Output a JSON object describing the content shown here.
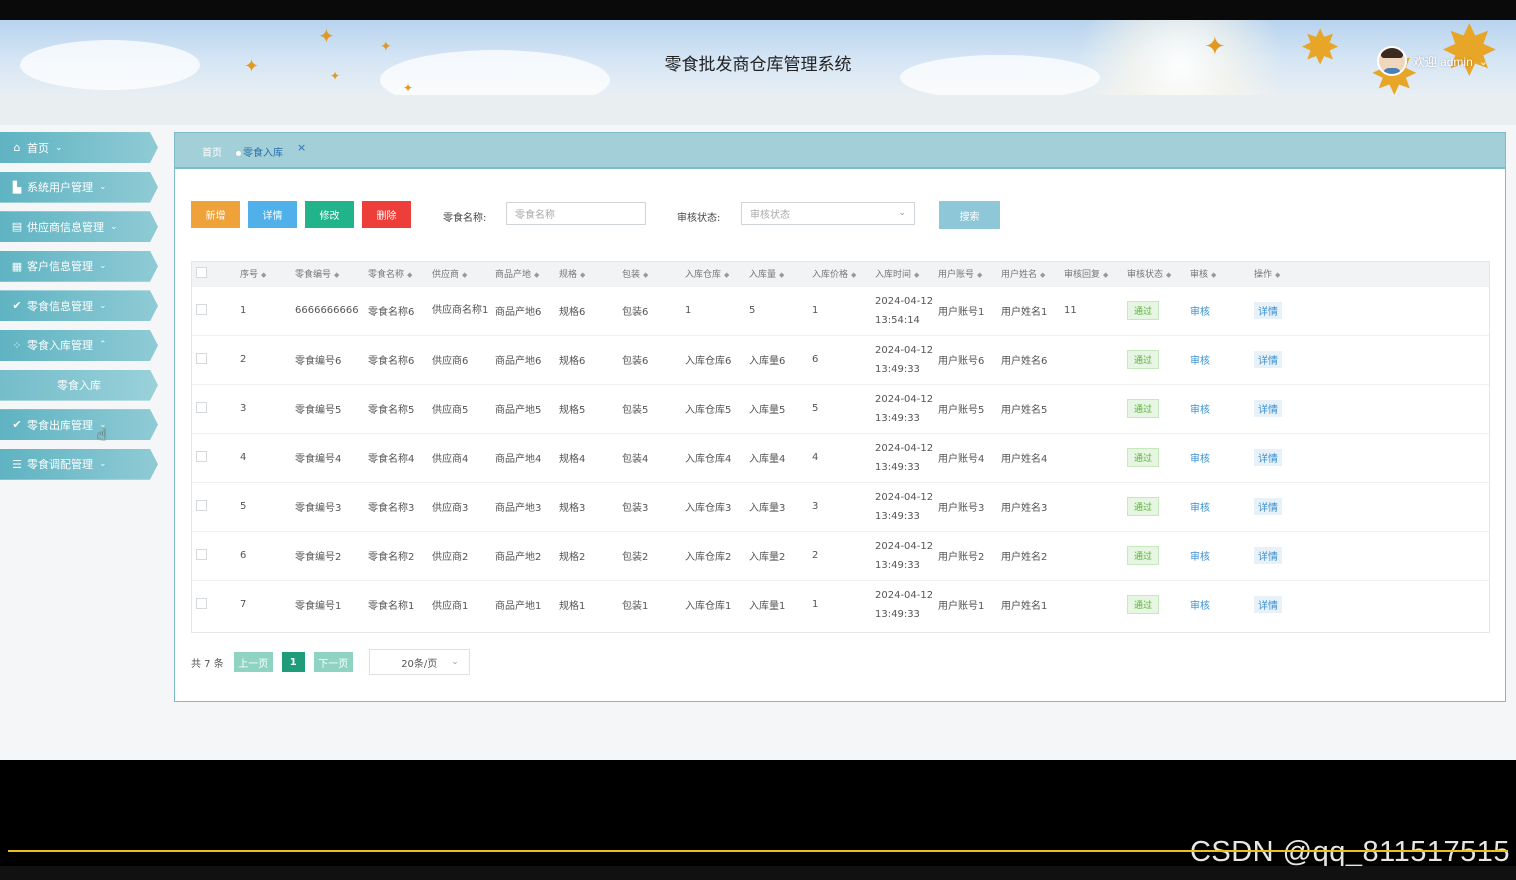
{
  "header": {
    "title": "零食批发商仓库管理系统",
    "welcome": "欢迎 admin"
  },
  "sidebar": {
    "items": [
      {
        "label": "首页",
        "icon": "home-icon",
        "caret": "⌄"
      },
      {
        "label": "系统用户管理",
        "icon": "user-icon",
        "caret": "⌄"
      },
      {
        "label": "供应商信息管理",
        "icon": "card-icon",
        "caret": "⌄"
      },
      {
        "label": "客户信息管理",
        "icon": "grid-icon",
        "caret": "⌄"
      },
      {
        "label": "零食信息管理",
        "icon": "check-circle-icon",
        "caret": "⌄"
      },
      {
        "label": "零食入库管理",
        "icon": "apps-icon",
        "caret": "⌃"
      },
      {
        "label": "零食入库",
        "icon": "",
        "caret": ""
      },
      {
        "label": "零食出库管理",
        "icon": "check-circle-icon",
        "caret": "⌄"
      },
      {
        "label": "零食调配管理",
        "icon": "list-icon",
        "caret": "⌄"
      }
    ]
  },
  "breadcrumb": {
    "home": "首页",
    "current": "零食入库",
    "close": "×"
  },
  "toolbar": {
    "add": "新增",
    "detail": "详情",
    "edit": "修改",
    "delete": "删除",
    "name_label": "零食名称:",
    "name_placeholder": "零食名称",
    "status_label": "审核状态:",
    "status_placeholder": "审核状态",
    "search": "搜索"
  },
  "table": {
    "columns": [
      "序号",
      "零食编号",
      "零食名称",
      "供应商",
      "商品产地",
      "规格",
      "包装",
      "入库仓库",
      "入库量",
      "入库价格",
      "入库时间",
      "用户账号",
      "用户姓名",
      "审核回复",
      "审核状态",
      "审核",
      "操作"
    ],
    "rows": [
      {
        "no": "1",
        "code": "6666666666",
        "name": "零食名称6",
        "supplier": "供应商名称1",
        "origin": "商品产地6",
        "spec": "规格6",
        "pack": "包装6",
        "warehouse": "1",
        "qty": "5",
        "price": "1",
        "time": "2024-04-12 13:54:14",
        "account": "用户账号1",
        "username": "用户姓名1",
        "reply": "11",
        "status": "通过",
        "audit": "审核",
        "op": "详情"
      },
      {
        "no": "2",
        "code": "零食编号6",
        "name": "零食名称6",
        "supplier": "供应商6",
        "origin": "商品产地6",
        "spec": "规格6",
        "pack": "包装6",
        "warehouse": "入库仓库6",
        "qty": "入库量6",
        "price": "6",
        "time": "2024-04-12 13:49:33",
        "account": "用户账号6",
        "username": "用户姓名6",
        "reply": "",
        "status": "通过",
        "audit": "审核",
        "op": "详情"
      },
      {
        "no": "3",
        "code": "零食编号5",
        "name": "零食名称5",
        "supplier": "供应商5",
        "origin": "商品产地5",
        "spec": "规格5",
        "pack": "包装5",
        "warehouse": "入库仓库5",
        "qty": "入库量5",
        "price": "5",
        "time": "2024-04-12 13:49:33",
        "account": "用户账号5",
        "username": "用户姓名5",
        "reply": "",
        "status": "通过",
        "audit": "审核",
        "op": "详情"
      },
      {
        "no": "4",
        "code": "零食编号4",
        "name": "零食名称4",
        "supplier": "供应商4",
        "origin": "商品产地4",
        "spec": "规格4",
        "pack": "包装4",
        "warehouse": "入库仓库4",
        "qty": "入库量4",
        "price": "4",
        "time": "2024-04-12 13:49:33",
        "account": "用户账号4",
        "username": "用户姓名4",
        "reply": "",
        "status": "通过",
        "audit": "审核",
        "op": "详情"
      },
      {
        "no": "5",
        "code": "零食编号3",
        "name": "零食名称3",
        "supplier": "供应商3",
        "origin": "商品产地3",
        "spec": "规格3",
        "pack": "包装3",
        "warehouse": "入库仓库3",
        "qty": "入库量3",
        "price": "3",
        "time": "2024-04-12 13:49:33",
        "account": "用户账号3",
        "username": "用户姓名3",
        "reply": "",
        "status": "通过",
        "audit": "审核",
        "op": "详情"
      },
      {
        "no": "6",
        "code": "零食编号2",
        "name": "零食名称2",
        "supplier": "供应商2",
        "origin": "商品产地2",
        "spec": "规格2",
        "pack": "包装2",
        "warehouse": "入库仓库2",
        "qty": "入库量2",
        "price": "2",
        "time": "2024-04-12 13:49:33",
        "account": "用户账号2",
        "username": "用户姓名2",
        "reply": "",
        "status": "通过",
        "audit": "审核",
        "op": "详情"
      },
      {
        "no": "7",
        "code": "零食编号1",
        "name": "零食名称1",
        "supplier": "供应商1",
        "origin": "商品产地1",
        "spec": "规格1",
        "pack": "包装1",
        "warehouse": "入库仓库1",
        "qty": "入库量1",
        "price": "1",
        "time": "2024-04-12 13:49:33",
        "account": "用户账号1",
        "username": "用户姓名1",
        "reply": "",
        "status": "通过",
        "audit": "审核",
        "op": "详情"
      }
    ]
  },
  "pagination": {
    "total": "共 7 条",
    "prev": "上一页",
    "page": "1",
    "next": "下一页",
    "page_size": "20条/页"
  },
  "watermark": "CSDN @qq_811517515",
  "colors": {
    "accent": "#5fb3c2",
    "add": "#f0a23a",
    "detail": "#4fb0ea",
    "edit": "#21b38a",
    "delete": "#ee3e3a",
    "progress": "#e8c21b"
  }
}
